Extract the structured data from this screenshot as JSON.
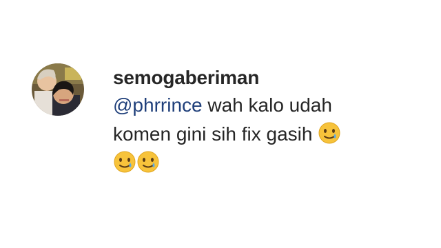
{
  "comment": {
    "username": "semogaberiman",
    "mention": "@phrrince",
    "text_line1": "wah kalo udah",
    "text_line2": "komen gini sih fix gasih",
    "emojis_inline": [
      "smiling-face-with-tear"
    ],
    "emojis_row": [
      "smiling-face-with-tear",
      "smiling-face-with-tear"
    ]
  },
  "colors": {
    "username": "#262626",
    "text": "#262626",
    "mention": "#1f3f7a",
    "emoji_face": "#f7c33b",
    "emoji_tear": "#5aa9e6"
  }
}
